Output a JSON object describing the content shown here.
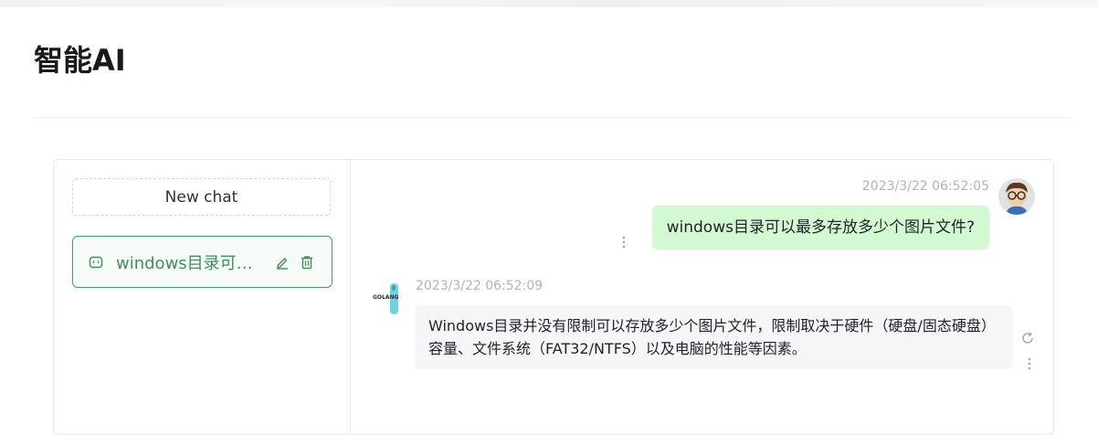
{
  "page": {
    "title": "智能AI"
  },
  "sidebar": {
    "new_chat_label": "New chat",
    "conversations": [
      {
        "title": "windows目录可以最多存放多少个图片文件?",
        "active": true
      }
    ]
  },
  "messages": [
    {
      "role": "user",
      "timestamp": "2023/3/22 06:52:05",
      "text": "windows目录可以最多存放多少个图片文件?"
    },
    {
      "role": "assistant",
      "timestamp": "2023/3/22 06:52:09",
      "text": "Windows目录并没有限制可以存放多少个图片文件，限制取决于硬件（硬盘/固态硬盘）容量、文件系统（FAT32/NTFS）以及电脑的性能等因素。",
      "avatar_text": "GOLANG"
    }
  ],
  "colors": {
    "accent": "#4c9a67",
    "user_bubble": "#d2f9d1",
    "bot_bubble": "#f4f6f8"
  },
  "icons": [
    "chat-icon",
    "edit-icon",
    "delete-icon",
    "more-vertical-icon",
    "refresh-icon"
  ]
}
